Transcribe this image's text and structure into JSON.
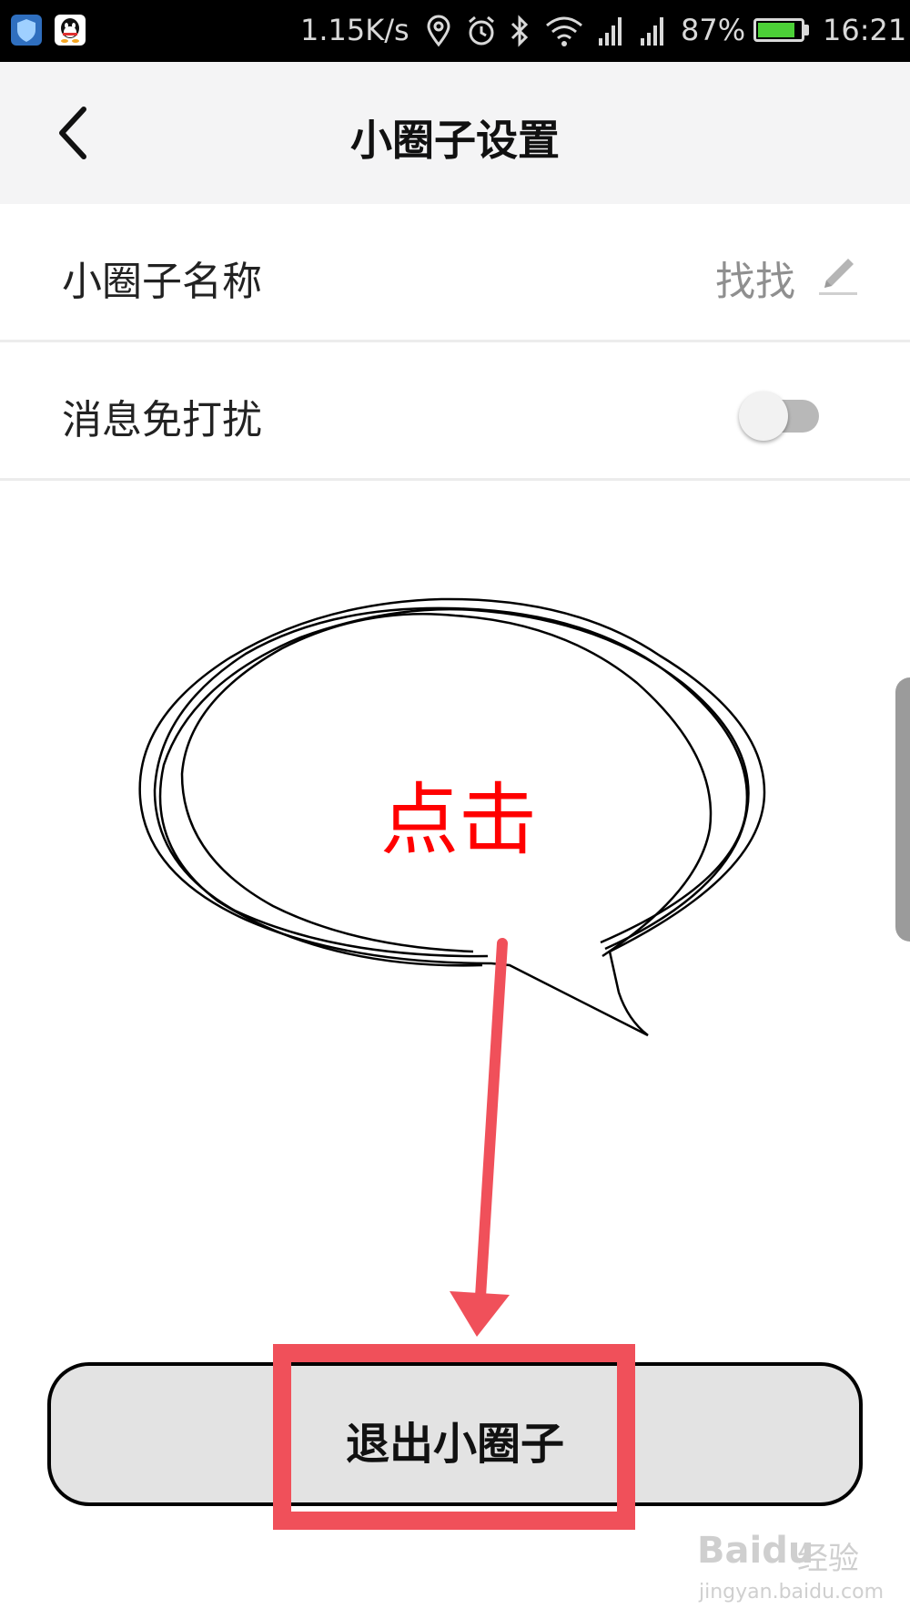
{
  "status_bar": {
    "speed": "1.15K/s",
    "battery_pct": "87%",
    "battery_level": 0.87,
    "time": "16:21",
    "icons": [
      "shield-icon",
      "qq-icon",
      "location-icon",
      "alarm-icon",
      "bluetooth-icon",
      "wifi-icon",
      "signal-icon",
      "signal-icon",
      "battery-icon"
    ]
  },
  "header": {
    "title": "小圈子设置",
    "back_icon": "chevron-left-icon"
  },
  "settings": {
    "name_label": "小圈子名称",
    "name_value": "找找",
    "edit_icon": "pencil-icon",
    "mute_label": "消息免打扰",
    "mute_enabled": false
  },
  "annotation": {
    "text": "点击",
    "color": "#ff0000",
    "arrow_color": "#f0505a"
  },
  "exit": {
    "label": "退出小圈子",
    "highlight_color": "#f0505a"
  },
  "watermark": {
    "brand": "Baidu",
    "suffix": "经验",
    "url": "jingyan.baidu.com"
  }
}
